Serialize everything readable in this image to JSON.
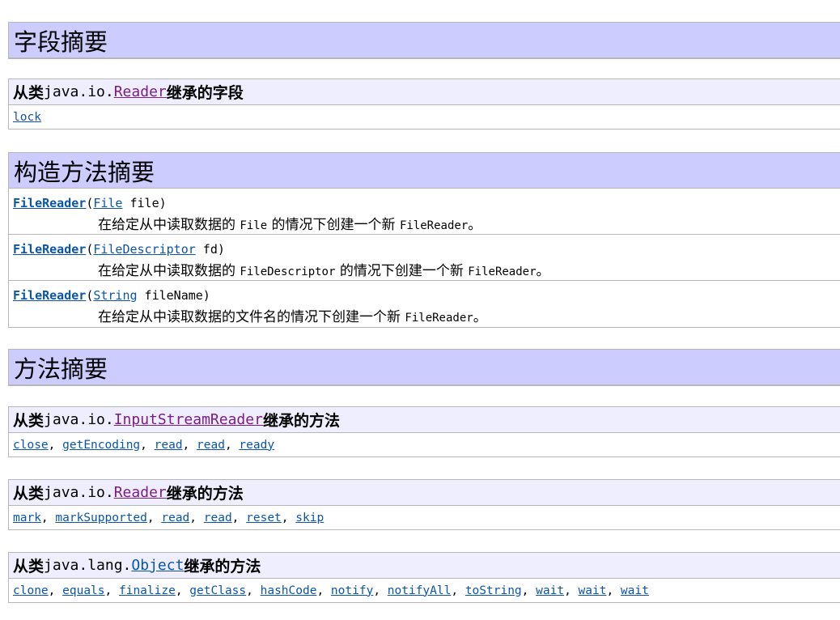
{
  "field_summary": {
    "title": "字段摘要",
    "inherited": {
      "prefix": "从类",
      "package": "java.io.",
      "class_link": "Reader",
      "suffix": "继承的字段",
      "fields": [
        "lock"
      ]
    }
  },
  "ctor_summary": {
    "title": "构造方法摘要",
    "rows": [
      {
        "name": "FileReader",
        "open": "(",
        "param_type": "File",
        "param_name": " file)",
        "desc_pre": "在给定从中读取数据的 ",
        "desc_code": "File",
        "desc_mid": " 的情况下创建一个新 ",
        "desc_code2": "FileReader",
        "desc_end": "。"
      },
      {
        "name": "FileReader",
        "open": "(",
        "param_type": "FileDescriptor",
        "param_name": " fd)",
        "desc_pre": "在给定从中读取数据的 ",
        "desc_code": "FileDescriptor",
        "desc_mid": " 的情况下创建一个新 ",
        "desc_code2": "FileReader",
        "desc_end": "。"
      },
      {
        "name": "FileReader",
        "open": "(",
        "param_type": "String",
        "param_name": " fileName)",
        "desc_pre": "在给定从中读取数据的文件名的情况下创建一个新 ",
        "desc_code": "",
        "desc_mid": "",
        "desc_code2": "FileReader",
        "desc_end": "。"
      }
    ]
  },
  "method_summary": {
    "title": "方法摘要",
    "inherited": [
      {
        "prefix": "从类",
        "package": "java.io.",
        "class_link": "InputStreamReader",
        "suffix": "继承的方法",
        "methods": [
          "close",
          "getEncoding",
          "read",
          "read",
          "ready"
        ]
      },
      {
        "prefix": "从类",
        "package": "java.io.",
        "class_link": "Reader",
        "suffix": "继承的方法",
        "methods": [
          "mark",
          "markSupported",
          "read",
          "read",
          "reset",
          "skip"
        ]
      },
      {
        "prefix": "从类",
        "package": "java.lang.",
        "class_link": "Object",
        "suffix": "继承的方法",
        "methods": [
          "clone",
          "equals",
          "finalize",
          "getClass",
          "hashCode",
          "notify",
          "notifyAll",
          "toString",
          "wait",
          "wait",
          "wait"
        ]
      }
    ]
  },
  "separator": ", "
}
